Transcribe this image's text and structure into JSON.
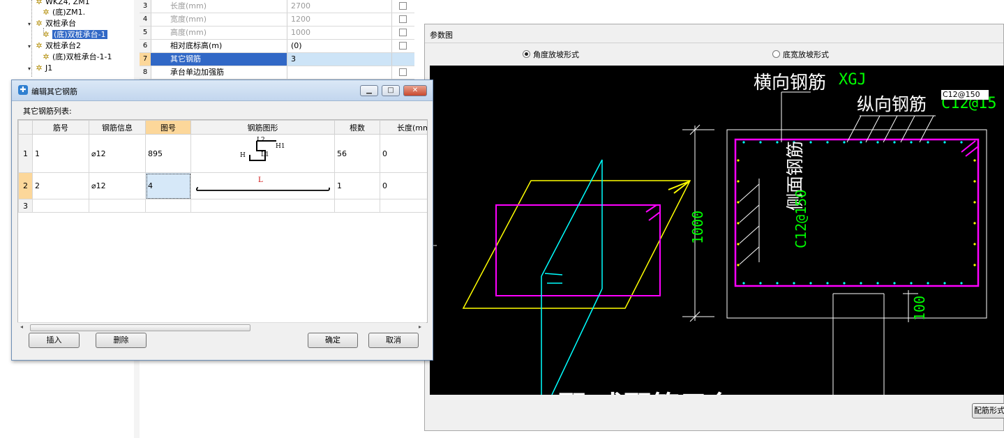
{
  "tree": {
    "items": [
      {
        "label": "WKZ4, ZM1",
        "expander": "",
        "level": 1
      },
      {
        "label": "(底)ZM1.",
        "expander": "",
        "level": 2
      },
      {
        "label": "双桩承台",
        "expander": "▾",
        "level": 1
      },
      {
        "label": "(底)双桩承台-1",
        "expander": "",
        "level": 2,
        "selected": true
      },
      {
        "label": "双桩承台2",
        "expander": "▾",
        "level": 1
      },
      {
        "label": "(底)双桩承台-1-1",
        "expander": "",
        "level": 2
      },
      {
        "label": "J1",
        "expander": "▾",
        "level": 1
      }
    ]
  },
  "properties": {
    "rows": [
      {
        "num": "3",
        "name": "长度(mm)",
        "value": "2700",
        "checkbox": true
      },
      {
        "num": "4",
        "name": "宽度(mm)",
        "value": "1200",
        "checkbox": true
      },
      {
        "num": "5",
        "name": "高度(mm)",
        "value": "1000",
        "checkbox": true
      },
      {
        "num": "6",
        "name": "相对底标高(m)",
        "value": "(0)",
        "checkbox": true
      },
      {
        "num": "7",
        "name": "其它钢筋",
        "value": "3",
        "checkbox": false
      },
      {
        "num": "8",
        "name": "承台单边加强筋",
        "value": "",
        "checkbox": true
      }
    ]
  },
  "dialog": {
    "title": "编辑其它钢筋",
    "list_label": "其它钢筋列表:",
    "columns": [
      "",
      "筋号",
      "钢筋信息",
      "图号",
      "钢筋图形",
      "根数",
      "长度(mm"
    ],
    "rows": [
      {
        "rn": "1",
        "jinhao": "1",
        "info": "⌀12",
        "tuhao": "895",
        "count": "56",
        "length": "0"
      },
      {
        "rn": "2",
        "jinhao": "2",
        "info": "⌀12",
        "tuhao": "4",
        "count": "1",
        "length": "0"
      },
      {
        "rn": "3",
        "jinhao": "",
        "info": "",
        "tuhao": "",
        "count": "",
        "length": ""
      }
    ],
    "shape1": {
      "l2": "L2",
      "h1": "H1",
      "h": "H",
      "l1": "L1"
    },
    "shape2": {
      "l": "L"
    },
    "buttons": {
      "insert": "插入",
      "delete": "删除",
      "ok": "确定",
      "cancel": "取消"
    },
    "minimize": "▁",
    "maximize": "□",
    "close": "✕"
  },
  "param_window": {
    "title": "参数图",
    "radio1": "角度放坡形式",
    "radio2": "底宽放坡形式",
    "button": "配筋形式"
  },
  "drawing": {
    "transverse_label": "横向钢筋",
    "transverse_code": "XGJ",
    "longitudinal_label": "纵向钢筋",
    "longitudinal_code": "C12@15",
    "input_value": "C12@150",
    "side_label": "侧面钢筋",
    "side_code": "C12@150",
    "dim_height": "1000",
    "dim_small": "100",
    "bottom_text": "配 式配筋示台"
  },
  "colors": {
    "accent_blue": "#3168c6",
    "cad_background": "#000000",
    "magenta": "#ff00ff",
    "yellow": "#ffff00",
    "cyan": "#00ffff",
    "green": "#00ff00"
  }
}
